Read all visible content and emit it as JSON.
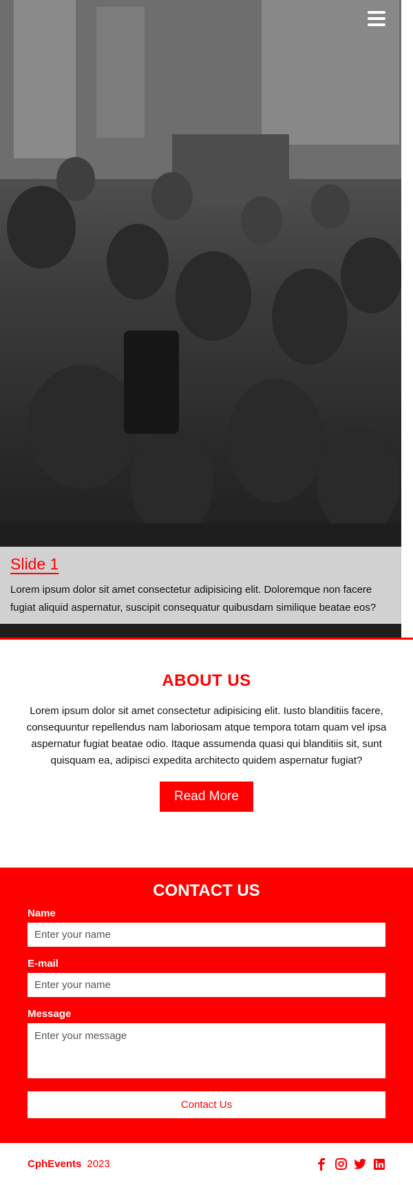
{
  "menu": {
    "icon": "hamburger-icon"
  },
  "slide": {
    "title": "Slide 1",
    "text": "Lorem ipsum dolor sit amet consectetur adipisicing elit. Doloremque non facere fugiat aliquid aspernatur, suscipit consequatur quibusdam similique beatae eos?"
  },
  "about": {
    "title": "ABOUT US",
    "text": "Lorem ipsum dolor sit amet consectetur adipisicing elit. Iusto blanditiis facere, consequuntur repellendus nam laboriosam atque tempora totam quam vel ipsa aspernatur fugiat beatae odio. Itaque assumenda quasi qui blanditiis sit, sunt quisquam ea, adipisci expedita architecto quidem aspernatur fugiat?",
    "button": "Read More"
  },
  "contact": {
    "title": "CONTACT US",
    "name_label": "Name",
    "name_placeholder": "Enter your name",
    "email_label": "E-mail",
    "email_placeholder": "Enter your name",
    "message_label": "Message",
    "message_placeholder": "Enter your message",
    "button": "Contact Us"
  },
  "footer": {
    "brand": "CphEvents",
    "year": "2023",
    "socials": [
      "facebook-icon",
      "instagram-icon",
      "twitter-icon",
      "linkedin-icon"
    ]
  },
  "colors": {
    "accent": "#ff0000",
    "caption_bg": "#e4e4e4"
  }
}
